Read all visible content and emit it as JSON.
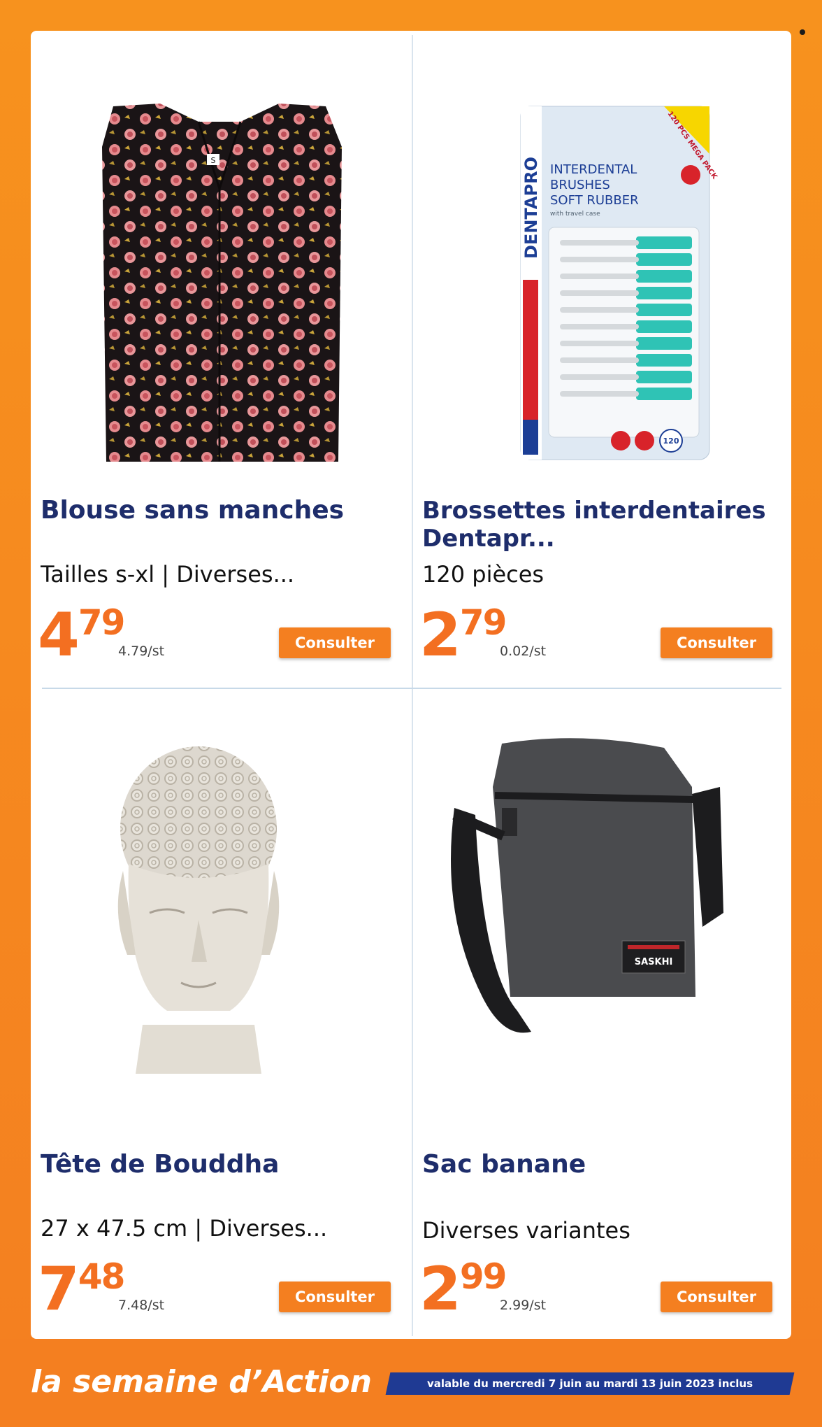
{
  "products": [
    {
      "title": "Blouse sans manches",
      "subtitle": "Tailles s-xl | Diverses...",
      "price_euros": "4",
      "price_cents": "79",
      "unit_price": "4.79/st",
      "button_label": "Consulter",
      "image": "sleeveless-blouse-image",
      "image_text": "S"
    },
    {
      "title": "Brossettes interdentaires Dentapr...",
      "subtitle": "120 pièces",
      "price_euros": "2",
      "price_cents": "79",
      "unit_price": "0.02/st",
      "button_label": "Consulter",
      "image": "interdental-brushes-pack-image",
      "image_text": {
        "brand": "DENTAPRO",
        "line1": "INTERDENTAL",
        "line2": "BRUSHES",
        "line3": "SOFT RUBBER",
        "line4": "with travel case",
        "badge": "120 PCS MEGA PACK",
        "count": "120"
      }
    },
    {
      "title": "Tête de Bouddha",
      "subtitle": "27 x 47.5 cm | Diverses...",
      "price_euros": "7",
      "price_cents": "48",
      "unit_price": "7.48/st",
      "button_label": "Consulter",
      "image": "buddha-head-statue-image"
    },
    {
      "title": "Sac banane",
      "subtitle": "Diverses variantes",
      "price_euros": "2",
      "price_cents": "99",
      "unit_price": "2.99/st",
      "button_label": "Consulter",
      "image": "crossbody-bag-image",
      "image_text": "SASKHI"
    }
  ],
  "footer": {
    "slogan": "la semaine d’Action",
    "validity": "valable du mercredi 7 juin au mardi 13 juin 2023 inclus"
  },
  "colors": {
    "brand_orange": "#f47f20",
    "title_navy": "#1e2d6b",
    "validity_blue": "#1f3a93"
  }
}
